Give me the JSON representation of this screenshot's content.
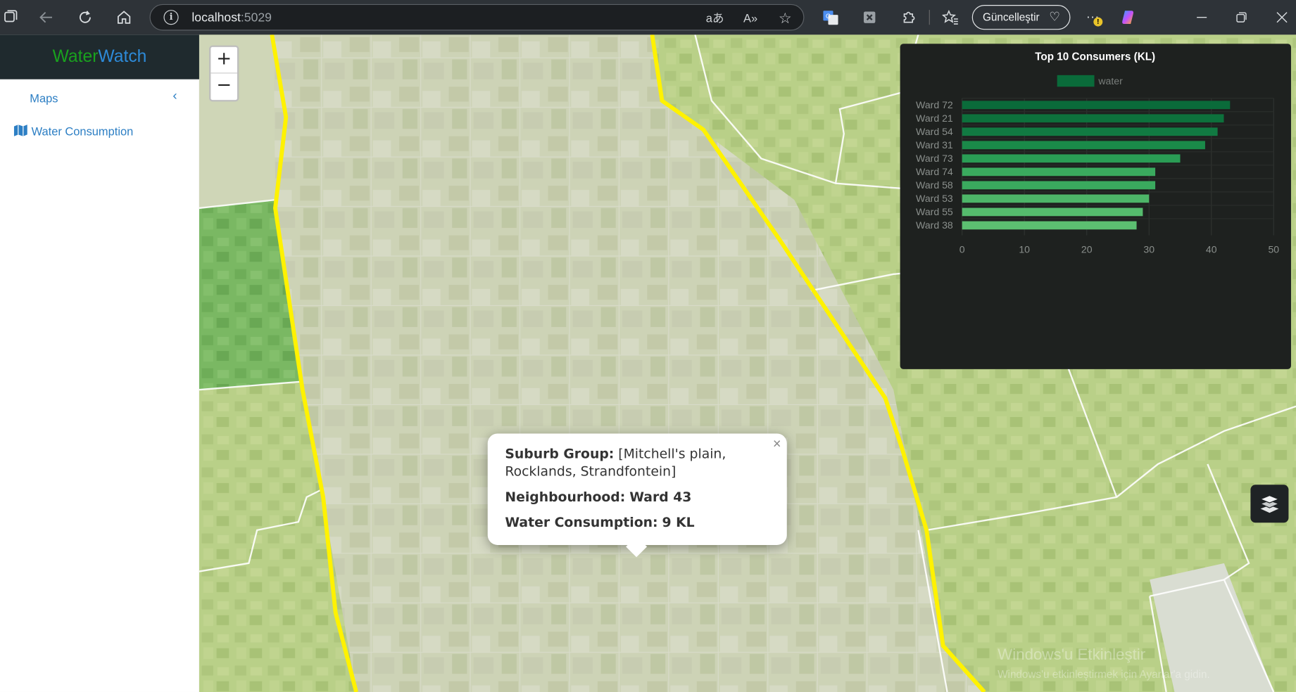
{
  "browser": {
    "url_host": "localhost",
    "url_port": ":5029",
    "update_button_label": "Güncelleştir",
    "icons": [
      "workspaces-icon",
      "back-icon",
      "refresh-icon",
      "home-icon",
      "site-info-icon",
      "translate-icon",
      "read-aloud-icon",
      "favorite-star-icon",
      "google-translate-extension-icon",
      "extension-icon",
      "extensions-puzzle-icon",
      "favorites-icon",
      "heart-pulse-icon",
      "more-icon",
      "copilot-icon",
      "minimize-icon",
      "restore-icon",
      "close-icon"
    ]
  },
  "sidebar": {
    "brand_part1": "Water",
    "brand_part2": "Watch",
    "brand_color1": "#19a11e",
    "brand_color2": "#2d8ad8",
    "section_label": "Maps",
    "items": [
      {
        "label": "Water Consumption",
        "icon": "map-icon"
      }
    ]
  },
  "map": {
    "zoom_in_label": "+",
    "zoom_out_label": "−",
    "boundary_color": "#fff200"
  },
  "chart_data": {
    "type": "bar",
    "orientation": "horizontal",
    "title": "Top 10 Consumers (KL)",
    "legend": "water",
    "categories": [
      "Ward 72",
      "Ward 21",
      "Ward 54",
      "Ward 31",
      "Ward 73",
      "Ward 74",
      "Ward 58",
      "Ward 53",
      "Ward 55",
      "Ward 38"
    ],
    "values": [
      43,
      42,
      41,
      39,
      35,
      31,
      31,
      30,
      29,
      28
    ],
    "xlim": [
      0,
      50
    ],
    "xticks": [
      0,
      10,
      20,
      30,
      40,
      50
    ],
    "bar_colors": [
      "#0a6b3a",
      "#0d713c",
      "#117a42",
      "#1a8a49",
      "#2a9d55",
      "#3aaa5e",
      "#3aaa5e",
      "#4db668",
      "#55bb6d",
      "#5cbf71"
    ]
  },
  "popup": {
    "suburb_label": "Suburb Group:",
    "suburb_value": "[Mitchell's plain, Rocklands, Strandfontein]",
    "neighbourhood_label": "Neighbourhood:",
    "neighbourhood_value": "Ward 43",
    "consumption_label": "Water Consumption:",
    "consumption_value": "9 KL",
    "close_label": "×"
  },
  "watermark": {
    "line1": "Windows'u Etkinleştir",
    "line2": "Windows'u etkinleştirmek için Ayarlar'a gidin."
  }
}
